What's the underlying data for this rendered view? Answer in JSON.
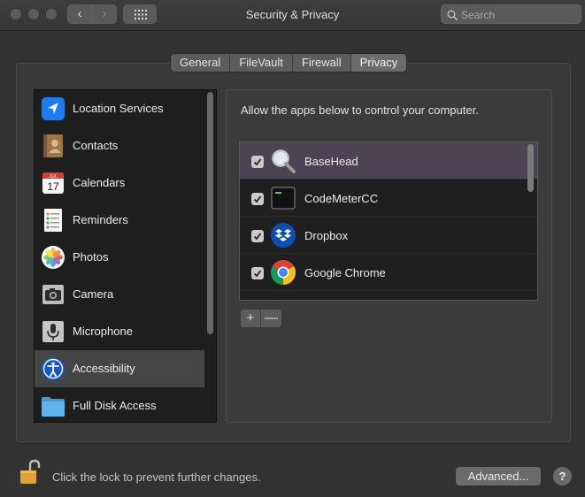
{
  "window": {
    "title": "Security & Privacy",
    "search_placeholder": "Search"
  },
  "tabs": [
    {
      "label": "General",
      "active": false
    },
    {
      "label": "FileVault",
      "active": false
    },
    {
      "label": "Firewall",
      "active": false
    },
    {
      "label": "Privacy",
      "active": true
    }
  ],
  "sidebar": {
    "items": [
      {
        "label": "Location Services",
        "icon": "location-arrow-icon"
      },
      {
        "label": "Contacts",
        "icon": "contacts-book-icon"
      },
      {
        "label": "Calendars",
        "icon": "calendar-icon",
        "icon_text_month": "JUL",
        "icon_text_day": "17"
      },
      {
        "label": "Reminders",
        "icon": "reminders-list-icon"
      },
      {
        "label": "Photos",
        "icon": "photos-flower-icon"
      },
      {
        "label": "Camera",
        "icon": "camera-icon"
      },
      {
        "label": "Microphone",
        "icon": "microphone-icon"
      },
      {
        "label": "Accessibility",
        "icon": "accessibility-icon",
        "selected": true
      },
      {
        "label": "Full Disk Access",
        "icon": "folder-icon"
      }
    ]
  },
  "privacy": {
    "instruction": "Allow the apps below to control your computer.",
    "apps": [
      {
        "label": "BaseHead",
        "checked": true,
        "selected": true,
        "icon": "magnifier-icon"
      },
      {
        "label": "CodeMeterCC",
        "checked": true,
        "selected": false,
        "icon": "terminal-icon"
      },
      {
        "label": "Dropbox",
        "checked": true,
        "selected": false,
        "icon": "dropbox-icon"
      },
      {
        "label": "Google Chrome",
        "checked": true,
        "selected": false,
        "icon": "chrome-icon"
      }
    ],
    "add_label": "+",
    "remove_label": "—"
  },
  "footer": {
    "lock_text": "Click the lock to prevent further changes.",
    "advanced_label": "Advanced...",
    "help_label": "?"
  },
  "colors": {
    "accent_blue": "#1d6ee0",
    "selected_row": "#4c4454",
    "sidebar_selected": "#454545"
  }
}
